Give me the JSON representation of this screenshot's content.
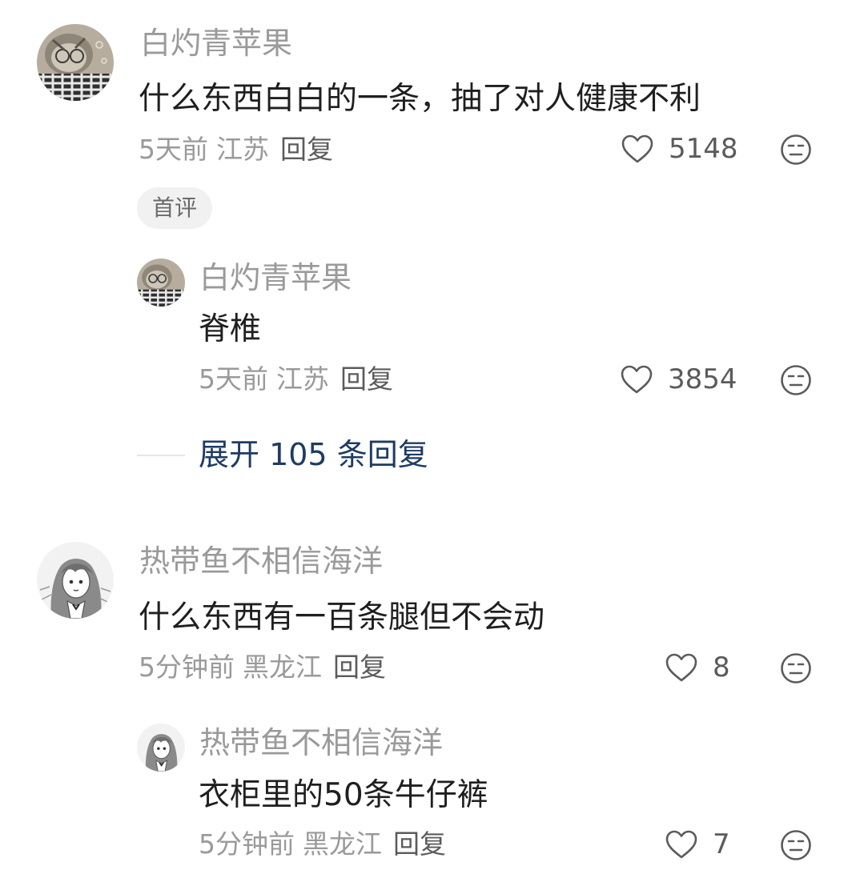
{
  "comments": [
    {
      "username": "白灼青苹果",
      "text": "什么东西白白的一条，抽了对人健康不利",
      "time": "5天前",
      "region": "江苏",
      "reply_label": "回复",
      "likes": "5148",
      "badge": "首评",
      "replies": [
        {
          "username": "白灼青苹果",
          "text": "脊椎",
          "time": "5天前",
          "region": "江苏",
          "reply_label": "回复",
          "likes": "3854"
        }
      ],
      "expand_label": "展开 105 条回复"
    },
    {
      "username": "热带鱼不相信海洋",
      "text": "什么东西有一百条腿但不会动",
      "time": "5分钟前",
      "region": "黑龙江",
      "reply_label": "回复",
      "likes": "8",
      "replies": [
        {
          "username": "热带鱼不相信海洋",
          "text": "衣柜里的50条牛仔裤",
          "time": "5分钟前",
          "region": "黑龙江",
          "reply_label": "回复",
          "likes": "7"
        }
      ]
    }
  ],
  "icons": {
    "like": "heart-outline-icon",
    "dislike": "meh-face-icon"
  },
  "colors": {
    "username": "#9a9a9a",
    "text": "#1f1f1f",
    "meta": "#9a9a9a",
    "action": "#5b5b5b",
    "link": "#1f3b63",
    "badge_bg": "#f1f1f1"
  }
}
